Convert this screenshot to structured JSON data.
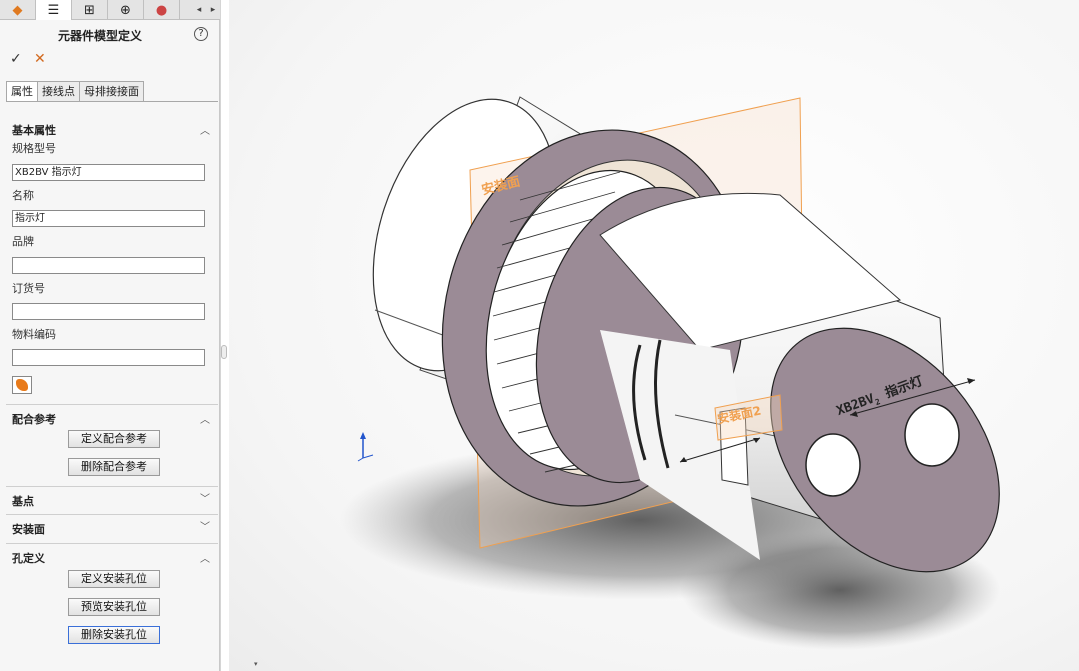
{
  "panel": {
    "title": "元器件模型定义",
    "help_symbol": "?",
    "ok_symbol": "✓",
    "cancel_symbol": "✕",
    "tabs": [
      {
        "label": "属性"
      },
      {
        "label": "接线点"
      },
      {
        "label": "母排接接面"
      }
    ],
    "sections": {
      "basic": {
        "title": "基本属性",
        "fields": {
          "model": {
            "label": "规格型号",
            "value": "XB2BV 指示灯"
          },
          "name": {
            "label": "名称",
            "value": "指示灯"
          },
          "brand": {
            "label": "品牌",
            "value": ""
          },
          "order_no": {
            "label": "订货号",
            "value": ""
          },
          "material_code": {
            "label": "物料编码",
            "value": ""
          }
        }
      },
      "mate": {
        "title": "配合参考",
        "define_button": "定义配合参考",
        "delete_button": "删除配合参考"
      },
      "base_point": {
        "title": "基点"
      },
      "mount_face": {
        "title": "安装面"
      },
      "hole": {
        "title": "孔定义",
        "define_button": "定义安装孔位",
        "preview_button": "预览安装孔位",
        "delete_button": "删除安装孔位"
      }
    }
  },
  "viewport": {
    "plane_label_1": "安装面",
    "plane_label_2": "安装面2",
    "engraving": "XB2BV",
    "engraving_sub": "2",
    "engraving_suffix": "指示灯",
    "corner_mark": "▾",
    "accent_color": "#f0a050"
  }
}
